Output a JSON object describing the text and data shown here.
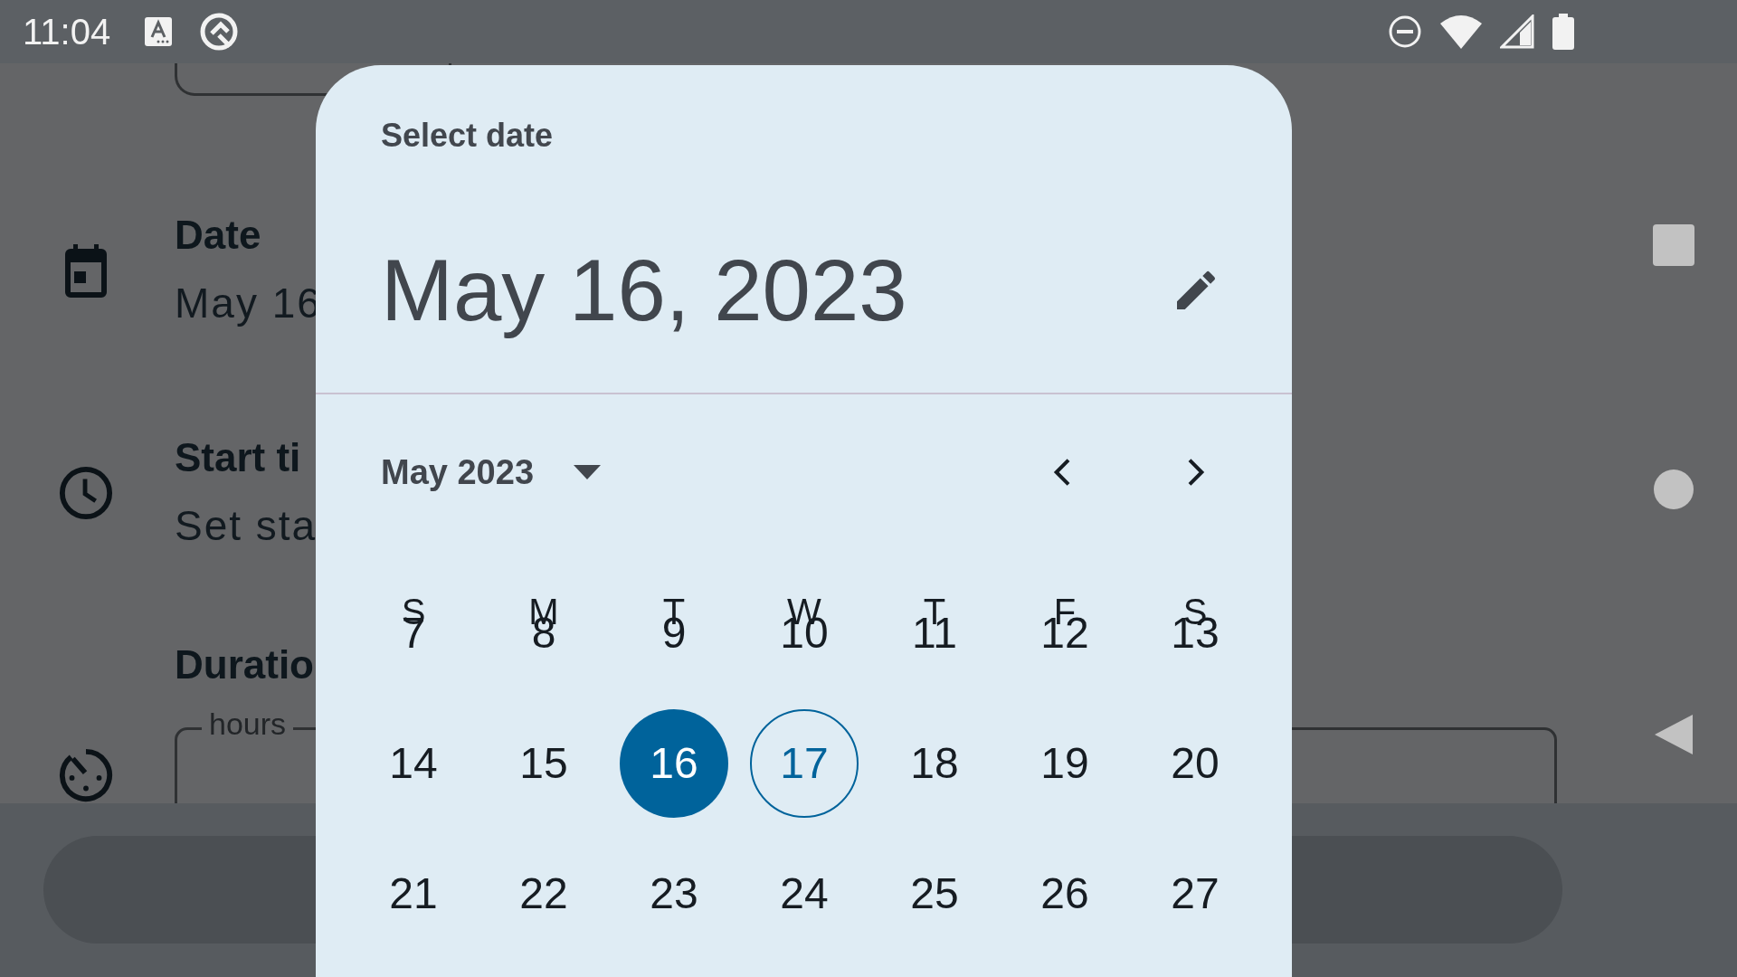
{
  "status_bar": {
    "time": "11:04"
  },
  "form": [
    {
      "kind": "date",
      "title": "Date",
      "value": "May 16"
    },
    {
      "kind": "time",
      "title": "Start ti",
      "value": "Set sta"
    },
    {
      "kind": "duration",
      "title": "Duratio",
      "field_label": "hours"
    }
  ],
  "dialog": {
    "headline": "Select date",
    "selected_date": "May 16, 2023",
    "month_label": "May 2023",
    "weekdays": [
      "S",
      "M",
      "T",
      "W",
      "T",
      "F",
      "S"
    ],
    "weeks": [
      [
        {
          "label": "7",
          "selected": false,
          "today": false
        },
        {
          "label": "8",
          "selected": false,
          "today": false
        },
        {
          "label": "9",
          "selected": false,
          "today": false
        },
        {
          "label": "10",
          "selected": false,
          "today": false
        },
        {
          "label": "11",
          "selected": false,
          "today": false
        },
        {
          "label": "12",
          "selected": false,
          "today": false
        },
        {
          "label": "13",
          "selected": false,
          "today": false
        }
      ],
      [
        {
          "label": "14",
          "selected": false,
          "today": false
        },
        {
          "label": "15",
          "selected": false,
          "today": false
        },
        {
          "label": "16",
          "selected": true,
          "today": false
        },
        {
          "label": "17",
          "selected": false,
          "today": true
        },
        {
          "label": "18",
          "selected": false,
          "today": false
        },
        {
          "label": "19",
          "selected": false,
          "today": false
        },
        {
          "label": "20",
          "selected": false,
          "today": false
        }
      ],
      [
        {
          "label": "21",
          "selected": false,
          "today": false
        },
        {
          "label": "22",
          "selected": false,
          "today": false
        },
        {
          "label": "23",
          "selected": false,
          "today": false
        },
        {
          "label": "24",
          "selected": false,
          "today": false
        },
        {
          "label": "25",
          "selected": false,
          "today": false
        },
        {
          "label": "26",
          "selected": false,
          "today": false
        },
        {
          "label": "27",
          "selected": false,
          "today": false
        }
      ]
    ]
  }
}
